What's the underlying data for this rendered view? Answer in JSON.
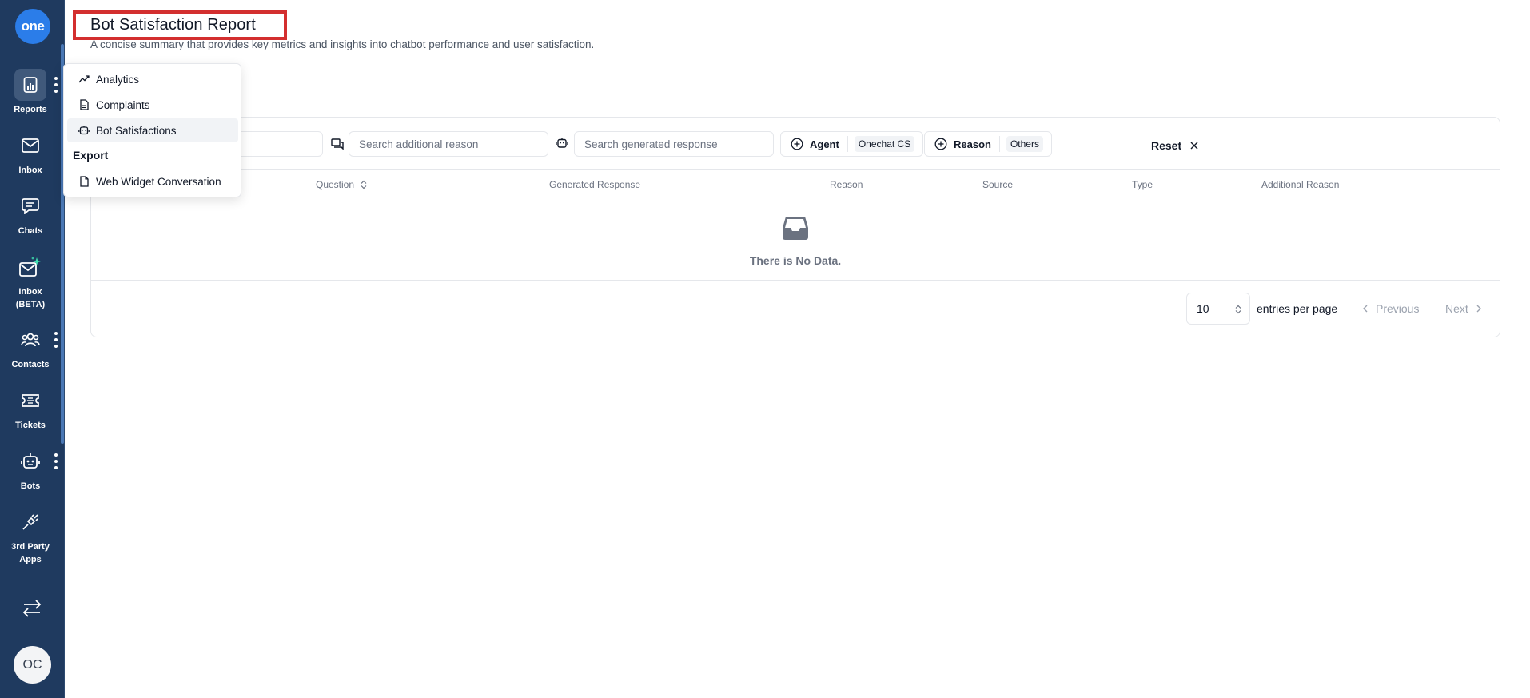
{
  "sidebar": {
    "logo": "one",
    "items": [
      {
        "label": "Reports",
        "icon": "bar-chart-icon"
      },
      {
        "label": "Inbox",
        "icon": "mail-icon"
      },
      {
        "label": "Chats",
        "icon": "chat-bubble-icon"
      },
      {
        "label": "Inbox (BETA)",
        "icon": "mail-sparkle-icon"
      },
      {
        "label": "Contacts",
        "icon": "users-icon"
      },
      {
        "label": "Tickets",
        "icon": "ticket-icon"
      },
      {
        "label": "Bots",
        "icon": "robot-icon"
      },
      {
        "label": "3rd Party Apps",
        "icon": "plug-icon"
      }
    ],
    "avatar_initials": "OC"
  },
  "header": {
    "title": "Bot Satisfaction Report",
    "subtitle": "A concise summary that provides key metrics and insights into chatbot performance and user satisfaction."
  },
  "menu": {
    "items": [
      {
        "label": "Analytics",
        "icon": "trend-line-icon"
      },
      {
        "label": "Complaints",
        "icon": "document-icon"
      },
      {
        "label": "Bot Satisfactions",
        "icon": "robot-icon"
      }
    ],
    "section_label": "Export",
    "export_items": [
      {
        "label": "Web Widget Conversation",
        "icon": "document-icon"
      }
    ]
  },
  "filters": {
    "additional_reason_placeholder": "Search additional reason",
    "generated_response_placeholder": "Search generated response",
    "agent_label": "Agent",
    "agent_value": "Onechat CS",
    "reason_label": "Reason",
    "reason_value": "Others",
    "reset_label": "Reset"
  },
  "table": {
    "columns": [
      "Question",
      "Generated Response",
      "Reason",
      "Source",
      "Type",
      "Additional Reason"
    ],
    "empty_text": "There is No Data."
  },
  "pagination": {
    "page_size": "10",
    "entries_label": "entries per page",
    "previous_label": "Previous",
    "next_label": "Next"
  },
  "colors": {
    "sidebar_bg": "#1f3a5f",
    "logo_bg": "#2b7de9",
    "highlight_border": "#d32f2f"
  }
}
